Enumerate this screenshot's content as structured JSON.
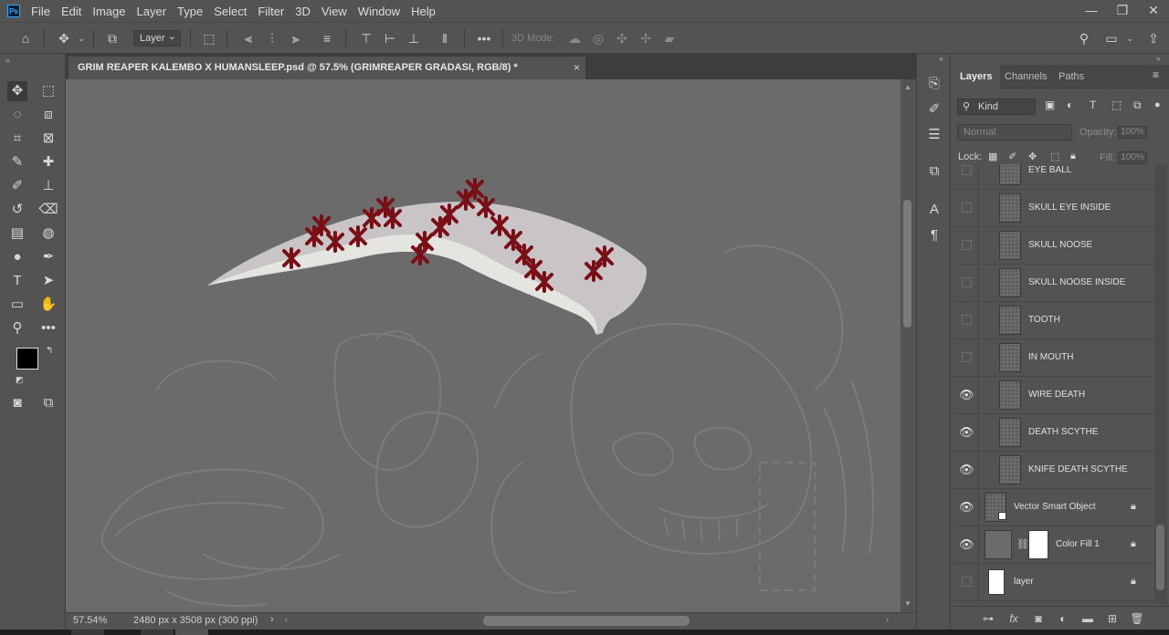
{
  "menubar": {
    "logo": "Ps",
    "items": [
      "File",
      "Edit",
      "Image",
      "Layer",
      "Type",
      "Select",
      "Filter",
      "3D",
      "View",
      "Window",
      "Help"
    ],
    "window_controls": [
      "—",
      "❐",
      "✕"
    ]
  },
  "options": {
    "layer_select": "Layer",
    "mode_3d": "3D Mode:"
  },
  "document": {
    "tab_title": "GRIM REAPER KALEMBO X HUMANSLEEP.psd @ 57.5% (GRIMREAPER GRADASI, RGB/8) *",
    "close": "×",
    "zoom": "57.54%",
    "doc_info": "2480 px x 3508 px (300 ppi)",
    "status_arrow": "›"
  },
  "panel": {
    "tabs": [
      "Layers",
      "Channels",
      "Paths"
    ],
    "kind": "Kind",
    "blend_mode": "Normal",
    "opacity_label": "Opacity:",
    "opacity_value": "100%",
    "lock_label": "Lock:",
    "fill_label": "Fill:",
    "fill_value": "100%"
  },
  "layers": [
    {
      "name": "EYE BALL",
      "visible": false,
      "thumb": "check",
      "locked": false
    },
    {
      "name": "SKULL EYE INSIDE",
      "visible": false,
      "thumb": "check",
      "locked": false
    },
    {
      "name": "SKULL NOOSE",
      "visible": false,
      "thumb": "check",
      "locked": false
    },
    {
      "name": "SKULL NOOSE INSIDE",
      "visible": false,
      "thumb": "check",
      "locked": false
    },
    {
      "name": "TOOTH",
      "visible": false,
      "thumb": "check",
      "locked": false
    },
    {
      "name": "IN MOUTH",
      "visible": false,
      "thumb": "check",
      "locked": false
    },
    {
      "name": "WIRE DEATH",
      "visible": true,
      "thumb": "check",
      "locked": false
    },
    {
      "name": "DEATH SCYTHE",
      "visible": true,
      "thumb": "check",
      "locked": false
    },
    {
      "name": "KNIFE DEATH SCYTHE",
      "visible": true,
      "thumb": "check",
      "locked": false
    },
    {
      "name": "Vector Smart Object",
      "visible": true,
      "thumb": "smart",
      "locked": true
    },
    {
      "name": "Color Fill 1",
      "visible": true,
      "thumb": "fill",
      "locked": true
    },
    {
      "name": "layer",
      "visible": false,
      "thumb": "white",
      "locked": true
    }
  ],
  "colors": {
    "scythe_blade": "#c9c5c6",
    "scythe_edge": "#e4e4e0",
    "stitch": "#7a0f16",
    "line_art": "#7b7b7b",
    "canvas": "#6b6b6b"
  }
}
